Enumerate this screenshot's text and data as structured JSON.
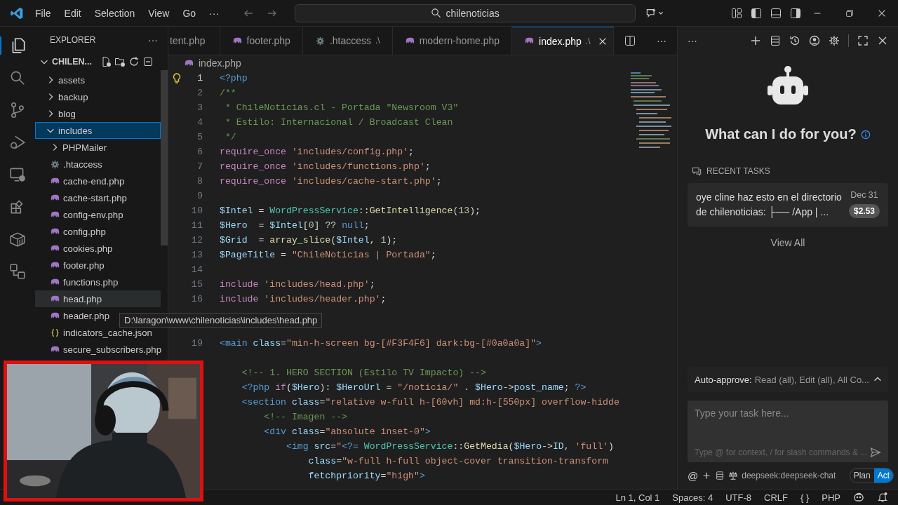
{
  "menu": [
    "File",
    "Edit",
    "Selection",
    "View",
    "Go",
    "···"
  ],
  "search": {
    "value": "chilenoticias"
  },
  "explorer": {
    "title": "EXPLORER",
    "more": "···",
    "folder": "CHILEN...",
    "items": [
      {
        "label": "assets",
        "kind": "folder",
        "expanded": false,
        "selected": false,
        "hovered": false
      },
      {
        "label": "backup",
        "kind": "folder",
        "expanded": false,
        "selected": false,
        "hovered": false
      },
      {
        "label": "blog",
        "kind": "folder",
        "expanded": false,
        "selected": false,
        "hovered": false
      },
      {
        "label": "includes",
        "kind": "folder",
        "expanded": true,
        "selected": true,
        "hovered": false,
        "children": [
          {
            "label": "PHPMailer",
            "kind": "folder",
            "expanded": false,
            "selected": false,
            "hovered": false
          },
          {
            "label": ".htaccess",
            "kind": "config",
            "selected": false,
            "hovered": false
          },
          {
            "label": "cache-end.php",
            "kind": "php",
            "selected": false,
            "hovered": false
          },
          {
            "label": "cache-start.php",
            "kind": "php",
            "selected": false,
            "hovered": false
          },
          {
            "label": "config-env.php",
            "kind": "php",
            "selected": false,
            "hovered": false
          },
          {
            "label": "config.php",
            "kind": "php",
            "selected": false,
            "hovered": false
          },
          {
            "label": "cookies.php",
            "kind": "php",
            "selected": false,
            "hovered": false
          },
          {
            "label": "footer.php",
            "kind": "php",
            "selected": false,
            "hovered": false
          },
          {
            "label": "functions.php",
            "kind": "php",
            "selected": false,
            "hovered": false
          },
          {
            "label": "head.php",
            "kind": "php",
            "selected": false,
            "hovered": true
          },
          {
            "label": "header.php",
            "kind": "php",
            "selected": false,
            "hovered": false
          },
          {
            "label": "indicators_cache.json",
            "kind": "json",
            "selected": false,
            "hovered": false
          },
          {
            "label": "secure_subscribers.php",
            "kind": "php",
            "selected": false,
            "hovered": false
          }
        ]
      }
    ]
  },
  "tooltip": "D:\\laragon\\www\\chilenoticias\\includes\\head.php",
  "tabs": [
    {
      "label": "tent.php",
      "kind": "none",
      "selected": false
    },
    {
      "label": "footer.php",
      "kind": "php",
      "selected": false
    },
    {
      "label": ".htaccess",
      "path": ".\\",
      "kind": "config",
      "selected": false
    },
    {
      "label": "modern-home.php",
      "kind": "php",
      "selected": false
    },
    {
      "label": "index.php",
      "path": ".\\",
      "kind": "php",
      "selected": true
    }
  ],
  "tab_more": "···",
  "breadcrumb": "index.php",
  "code": [
    {
      "number": "1",
      "tokens": [
        {
          "kind": "tag",
          "text": "<?php"
        }
      ]
    },
    {
      "number": "2",
      "tokens": [
        {
          "kind": "comment",
          "text": "/**"
        }
      ]
    },
    {
      "number": "3",
      "tokens": [
        {
          "kind": "comment",
          "text": " * ChileNoticias.cl - Portada \"Newsroom V3\""
        }
      ]
    },
    {
      "number": "4",
      "tokens": [
        {
          "kind": "comment",
          "text": " * Estilo: Internacional / Broadcast Clean"
        }
      ]
    },
    {
      "number": "5",
      "tokens": [
        {
          "kind": "comment",
          "text": " */"
        }
      ]
    },
    {
      "number": "6",
      "tokens": [
        {
          "kind": "keyword",
          "text": "require_once "
        },
        {
          "kind": "string",
          "text": "'includes/config.php'"
        },
        {
          "kind": "plain",
          "text": ";"
        }
      ]
    },
    {
      "number": "7",
      "tokens": [
        {
          "kind": "keyword",
          "text": "require_once "
        },
        {
          "kind": "string",
          "text": "'includes/functions.php'"
        },
        {
          "kind": "plain",
          "text": ";"
        }
      ]
    },
    {
      "number": "8",
      "tokens": [
        {
          "kind": "keyword",
          "text": "require_once "
        },
        {
          "kind": "string",
          "text": "'includes/cache-start.php'"
        },
        {
          "kind": "plain",
          "text": ";"
        }
      ]
    },
    {
      "number": "9"
    },
    {
      "number": "10",
      "tokens": [
        {
          "kind": "variable",
          "text": "$Intel"
        },
        {
          "kind": "plain",
          "text": " = "
        },
        {
          "kind": "class",
          "text": "WordPressService"
        },
        {
          "kind": "plain",
          "text": "::"
        },
        {
          "kind": "function",
          "text": "GetIntelligence"
        },
        {
          "kind": "plain",
          "text": "("
        },
        {
          "kind": "number",
          "text": "13"
        },
        {
          "kind": "plain",
          "text": ");"
        }
      ]
    },
    {
      "number": "11",
      "tokens": [
        {
          "kind": "variable",
          "text": "$Hero"
        },
        {
          "kind": "plain",
          "text": "  = "
        },
        {
          "kind": "variable",
          "text": "$Intel"
        },
        {
          "kind": "plain",
          "text": "["
        },
        {
          "kind": "number",
          "text": "0"
        },
        {
          "kind": "plain",
          "text": "] ?? "
        },
        {
          "kind": "tag",
          "text": "null"
        },
        {
          "kind": "plain",
          "text": ";"
        }
      ]
    },
    {
      "number": "12",
      "tokens": [
        {
          "kind": "variable",
          "text": "$Grid"
        },
        {
          "kind": "plain",
          "text": "  = "
        },
        {
          "kind": "function",
          "text": "array_slice"
        },
        {
          "kind": "plain",
          "text": "("
        },
        {
          "kind": "variable",
          "text": "$Intel"
        },
        {
          "kind": "plain",
          "text": ", "
        },
        {
          "kind": "number",
          "text": "1"
        },
        {
          "kind": "plain",
          "text": ");"
        }
      ]
    },
    {
      "number": "13",
      "tokens": [
        {
          "kind": "variable",
          "text": "$PageTitle"
        },
        {
          "kind": "plain",
          "text": " = "
        },
        {
          "kind": "string",
          "text": "\"ChileNoticias | Portada\""
        },
        {
          "kind": "plain",
          "text": ";"
        }
      ]
    },
    {
      "number": "14"
    },
    {
      "number": "15",
      "tokens": [
        {
          "kind": "keyword",
          "text": "include "
        },
        {
          "kind": "string",
          "text": "'includes/head.php'"
        },
        {
          "kind": "plain",
          "text": ";"
        }
      ]
    },
    {
      "number": "16",
      "tokens": [
        {
          "kind": "keyword",
          "text": "include "
        },
        {
          "kind": "string",
          "text": "'includes/header.php'"
        },
        {
          "kind": "plain",
          "text": ";"
        }
      ]
    },
    {
      "blank": true
    },
    {
      "blank": true
    },
    {
      "number": "19",
      "tokens": [
        {
          "kind": "tag",
          "text": "<main "
        },
        {
          "kind": "attribute",
          "text": "class"
        },
        {
          "kind": "plain",
          "text": "="
        },
        {
          "kind": "string",
          "text": "\"min-h-screen bg-[#F3F4F6] dark:bg-[#0a0a0a]\""
        },
        {
          "kind": "tag",
          "text": ">"
        }
      ]
    },
    {
      "blank": true
    },
    {
      "tokens": [
        {
          "kind": "comment",
          "text": "    <!-- 1. HERO SECTION (Estilo TV Impacto) -->"
        }
      ]
    },
    {
      "tokens": [
        {
          "kind": "tag",
          "text": "    <?php "
        },
        {
          "kind": "keyword",
          "text": "if"
        },
        {
          "kind": "plain",
          "text": "("
        },
        {
          "kind": "variable",
          "text": "$Hero"
        },
        {
          "kind": "plain",
          "text": "): "
        },
        {
          "kind": "variable",
          "text": "$HeroUrl"
        },
        {
          "kind": "plain",
          "text": " = "
        },
        {
          "kind": "string",
          "text": "\"/noticia/\""
        },
        {
          "kind": "plain",
          "text": " . "
        },
        {
          "kind": "variable",
          "text": "$Hero"
        },
        {
          "kind": "plain",
          "text": "->"
        },
        {
          "kind": "variable",
          "text": "post_name"
        },
        {
          "kind": "plain",
          "text": "; "
        },
        {
          "kind": "tag",
          "text": "?>"
        }
      ]
    },
    {
      "tokens": [
        {
          "kind": "tag",
          "text": "    <section "
        },
        {
          "kind": "attribute",
          "text": "class"
        },
        {
          "kind": "plain",
          "text": "="
        },
        {
          "kind": "string",
          "text": "\"relative w-full h-[60vh] md:h-[550px] overflow-hidde"
        }
      ]
    },
    {
      "tokens": [
        {
          "kind": "comment",
          "text": "        <!-- Imagen -->"
        }
      ]
    },
    {
      "tokens": [
        {
          "kind": "tag",
          "text": "        <div "
        },
        {
          "kind": "attribute",
          "text": "class"
        },
        {
          "kind": "plain",
          "text": "="
        },
        {
          "kind": "string",
          "text": "\"absolute inset-0\""
        },
        {
          "kind": "tag",
          "text": ">"
        }
      ]
    },
    {
      "tokens": [
        {
          "kind": "tag",
          "text": "            <img "
        },
        {
          "kind": "attribute",
          "text": "src"
        },
        {
          "kind": "plain",
          "text": "="
        },
        {
          "kind": "string",
          "text": "\""
        },
        {
          "kind": "tag",
          "text": "<?= "
        },
        {
          "kind": "class",
          "text": "WordPressService"
        },
        {
          "kind": "plain",
          "text": "::"
        },
        {
          "kind": "function",
          "text": "GetMedia"
        },
        {
          "kind": "plain",
          "text": "("
        },
        {
          "kind": "variable",
          "text": "$Hero"
        },
        {
          "kind": "plain",
          "text": "->"
        },
        {
          "kind": "variable",
          "text": "ID"
        },
        {
          "kind": "plain",
          "text": ", "
        },
        {
          "kind": "string",
          "text": "'full'"
        },
        {
          "kind": "plain",
          "text": ")"
        }
      ]
    },
    {
      "tokens": [
        {
          "kind": "attribute",
          "text": "                class"
        },
        {
          "kind": "plain",
          "text": "="
        },
        {
          "kind": "string",
          "text": "\"w-full h-full object-cover transition-transform"
        }
      ]
    },
    {
      "tokens": [
        {
          "kind": "attribute",
          "text": "                fetchpriority"
        },
        {
          "kind": "plain",
          "text": "="
        },
        {
          "kind": "string",
          "text": "\"high\""
        },
        {
          "kind": "tag",
          "text": ">"
        }
      ]
    }
  ],
  "assistant": {
    "more": "···",
    "heading": "What can I do for you?",
    "recent_label": "RECENT TASKS",
    "tasks": [
      {
        "text": "oye cline haz esto en el directorio de chilenoticias: ├── /App | ...",
        "date": "Dec 31",
        "cost": "$2.53"
      }
    ],
    "view_all": "View All",
    "auto_approve": {
      "label": "Auto-approve:",
      "value": "Read (all), Edit (all), All Co..."
    },
    "input": {
      "placeholder": "Type your task here...",
      "hint": "Type @ for context, / for slash commands & ..."
    },
    "at": "@",
    "model": "deepseek:deepseek-chat",
    "modes": [
      {
        "label": "Plan",
        "selected": false
      },
      {
        "label": "Act",
        "selected": true
      }
    ]
  },
  "status": {
    "position": "Ln 1, Col 1",
    "spaces": "Spaces: 4",
    "encoding": "UTF-8",
    "eol": "CRLF",
    "braces": "{ }",
    "language": "PHP"
  }
}
